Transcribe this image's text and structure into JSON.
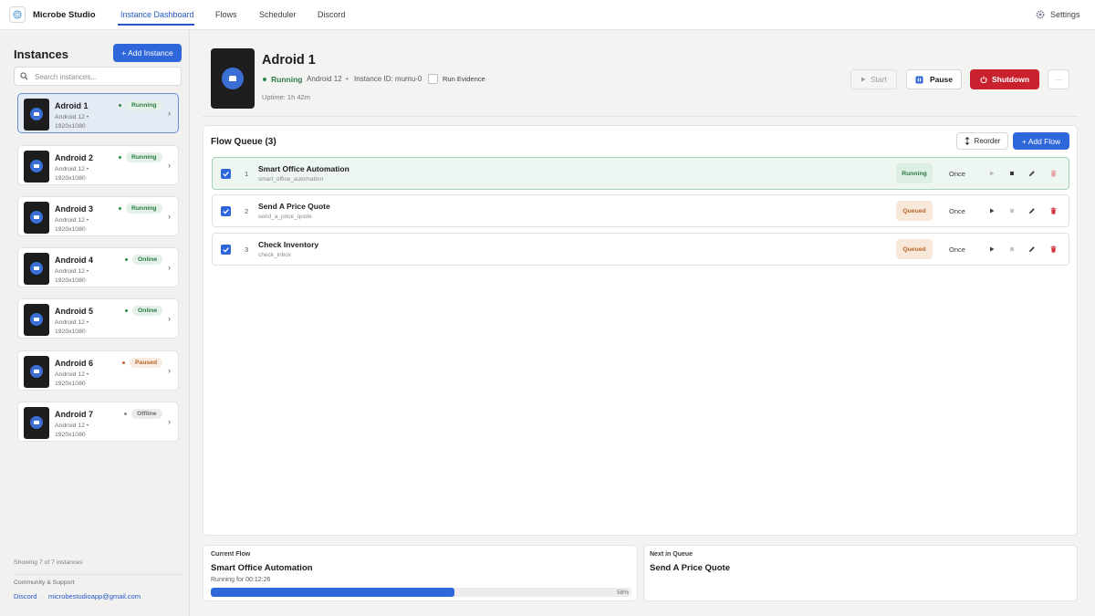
{
  "app": {
    "name": "Microbe Studio"
  },
  "nav": {
    "items": [
      {
        "label": "Instance Dashboard",
        "active": true
      },
      {
        "label": "Flows"
      },
      {
        "label": "Scheduler"
      },
      {
        "label": "Discord"
      }
    ],
    "settings_label": "Settings"
  },
  "sidebar": {
    "title": "Instances",
    "add_button": "+ Add Instance",
    "search_placeholder": "Search instances...",
    "instances": [
      {
        "name": "Adroid 1",
        "os": "Android 12",
        "bullet": "•",
        "resolution": "1920x1080",
        "status": "Running",
        "selected": true
      },
      {
        "name": "Android 2",
        "os": "Android 12",
        "bullet": "•",
        "resolution": "1920x1080",
        "status": "Running"
      },
      {
        "name": "Android 3",
        "os": "Android 12",
        "bullet": "•",
        "resolution": "1920x1080",
        "status": "Running"
      },
      {
        "name": "Android 4",
        "os": "Android 12",
        "bullet": "•",
        "resolution": "1920x1080",
        "status": "Online"
      },
      {
        "name": "Android 5",
        "os": "Android 12",
        "bullet": "•",
        "resolution": "1920x1080",
        "status": "Online"
      },
      {
        "name": "Android 6",
        "os": "Android 12",
        "bullet": "•",
        "resolution": "1920x1080",
        "status": "Paused"
      },
      {
        "name": "Android 7",
        "os": "Android 12",
        "bullet": "•",
        "resolution": "1920x1080",
        "status": "Offline"
      }
    ],
    "showing": "Showing 7 of 7 instances",
    "community_label": "Community & Support",
    "discord_link": "Discord",
    "separator": "·",
    "email": "microbestudioapp@gmail.com"
  },
  "instance": {
    "title": "Adroid 1",
    "status": "Running",
    "os": "Android 12",
    "bullet": "•",
    "instance_id": "Instance ID: mumu-0",
    "run_evidence_label": "Run Evidence",
    "run_evidence_checked": false,
    "uptime": "Uptime: 1h 42m",
    "buttons": {
      "start": "Start",
      "pause": "Pause",
      "shutdown": "Shutdown",
      "more": "···"
    }
  },
  "flow_queue": {
    "title": "Flow Queue (3)",
    "reorder_label": "Reorder",
    "add_flow_label": "+ Add Flow",
    "flows": [
      {
        "index": "1",
        "name": "Smart Office Automation",
        "id": "smart_office_automation",
        "status": "Running",
        "frequency": "Once",
        "checked": true
      },
      {
        "index": "2",
        "name": "Send A Price Quote",
        "id": "send_a_price_quote",
        "status": "Queued",
        "frequency": "Once",
        "checked": true
      },
      {
        "index": "3",
        "name": "Check Inventory",
        "id": "check_inbox",
        "status": "Queued",
        "frequency": "Once",
        "checked": true
      }
    ]
  },
  "current_flow": {
    "label": "Current Flow",
    "name": "Smart Office Automation",
    "running_for": "Running for 00:12:26",
    "progress_percent": 58,
    "progress_text": "58%"
  },
  "next_in_queue": {
    "label": "Next in Queue",
    "name": "Send A Price Quote"
  },
  "colors": {
    "accent": "#2f66d9",
    "danger": "#c9222e",
    "running": "#2c7a45",
    "queued": "#b86428"
  }
}
